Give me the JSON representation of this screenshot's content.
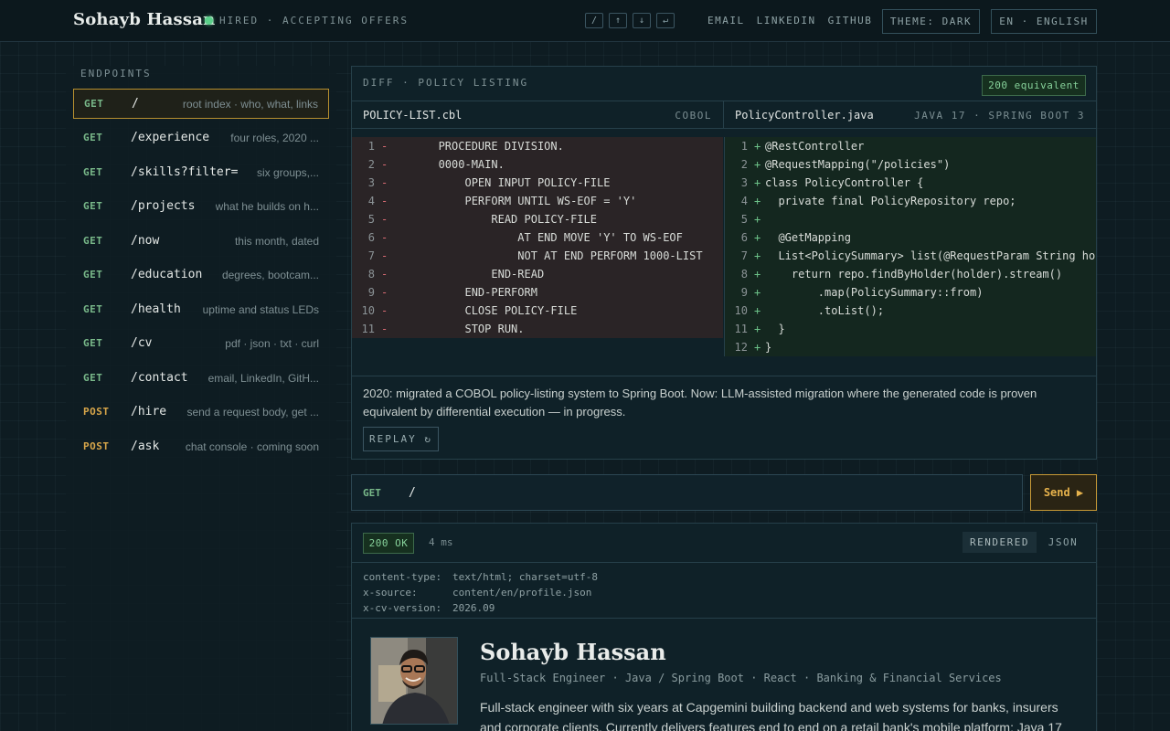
{
  "header": {
    "brand": "Sohayb Hassan",
    "status": "HIRED · ACCEPTING OFFERS",
    "keys": [
      "/",
      "↑",
      "↓",
      "↵"
    ],
    "nav": [
      "EMAIL",
      "LINKEDIN",
      "GITHUB"
    ],
    "theme": "THEME: DARK",
    "language": "EN · ENGLISH",
    "status_color": "#5bd08a"
  },
  "sidebar": {
    "title": "ENDPOINTS",
    "items": [
      {
        "method": "GET",
        "path": "/",
        "desc": "root index · who, what, links"
      },
      {
        "method": "GET",
        "path": "/experience",
        "desc": "four roles, 2020 ..."
      },
      {
        "method": "GET",
        "path": "/skills?filter=",
        "desc": "six groups,..."
      },
      {
        "method": "GET",
        "path": "/projects",
        "desc": "what he builds on h..."
      },
      {
        "method": "GET",
        "path": "/now",
        "desc": "this month, dated"
      },
      {
        "method": "GET",
        "path": "/education",
        "desc": "degrees, bootcam..."
      },
      {
        "method": "GET",
        "path": "/health",
        "desc": "uptime and status LEDs"
      },
      {
        "method": "GET",
        "path": "/cv",
        "desc": "pdf · json · txt · curl"
      },
      {
        "method": "GET",
        "path": "/contact",
        "desc": "email, LinkedIn, GitH..."
      },
      {
        "method": "POST",
        "path": "/hire",
        "desc": "send a request body, get ..."
      },
      {
        "method": "POST",
        "path": "/ask",
        "desc": "chat console · coming soon"
      }
    ]
  },
  "diff": {
    "title": "DIFF · POLICY LISTING",
    "badge": "200 equivalent",
    "left": {
      "file": "POLICY-LIST.cbl",
      "lang": "COBOL",
      "lines": [
        "       PROCEDURE DIVISION.",
        "       0000-MAIN.",
        "           OPEN INPUT POLICY-FILE",
        "           PERFORM UNTIL WS-EOF = 'Y'",
        "               READ POLICY-FILE",
        "                   AT END MOVE 'Y' TO WS-EOF",
        "                   NOT AT END PERFORM 1000-LIST",
        "               END-READ",
        "           END-PERFORM",
        "           CLOSE POLICY-FILE",
        "           STOP RUN."
      ]
    },
    "right": {
      "file": "PolicyController.java",
      "lang": "JAVA 17 · SPRING BOOT 3",
      "lines": [
        "@RestController",
        "@RequestMapping(\"/policies\")",
        "class PolicyController {",
        "  private final PolicyRepository repo;",
        "",
        "  @GetMapping",
        "  List<PolicySummary> list(@RequestParam String ho",
        "    return repo.findByHolder(holder).stream()",
        "        .map(PolicySummary::from)",
        "        .toList();",
        "  }",
        "}"
      ]
    },
    "note": "2020: migrated a COBOL policy-listing system to Spring Boot. Now: LLM-assisted migration where the generated code is proven equivalent by differential execution — in progress.",
    "replay": "REPLAY ↻"
  },
  "request": {
    "method": "GET",
    "path": "/",
    "send": "Send ▶"
  },
  "response": {
    "status": "200 OK",
    "time": "4 ms",
    "tabs": [
      "RENDERED",
      "JSON"
    ],
    "headers": [
      {
        "k": "content-type:",
        "v": "text/html; charset=utf-8"
      },
      {
        "k": "x-source:",
        "v": "content/en/profile.json"
      },
      {
        "k": "x-cv-version:",
        "v": "2026.09"
      }
    ],
    "profile": {
      "name": "Sohayb Hassan",
      "role": "Full-Stack Engineer · Java / Spring Boot · React · Banking & Financial Services",
      "bio": "Full-stack engineer with six years at Capgemini building backend and web systems for banks, insurers and corporate clients. Currently delivers features end to end on a retail bank's mobile platform: Java 17"
    }
  }
}
